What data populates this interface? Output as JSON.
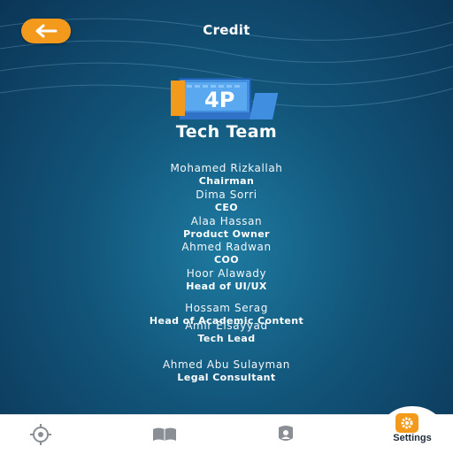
{
  "header": {
    "title": "Credit",
    "back_icon": "arrow-left-icon"
  },
  "team": {
    "title": "Tech Team",
    "logo_text": "4P"
  },
  "members": [
    {
      "name": "Mohamed Rizkallah",
      "role": "Chairman"
    },
    {
      "name": "Dima Sorri",
      "role": "CEO"
    },
    {
      "name": "Alaa Hassan",
      "role": "Product Owner"
    },
    {
      "name": "Ahmed Radwan",
      "role": "COO"
    },
    {
      "name": "Hoor Alawady",
      "role": "Head of UI/UX"
    },
    {
      "name": "Hossam Serag",
      "role": "Head of Academic Content"
    },
    {
      "name": "Amir Elsayyad",
      "role": "Tech Lead"
    },
    {
      "name": "Ahmed Abu Sulayman",
      "role": "Legal Consultant"
    }
  ],
  "nav": {
    "items": [
      {
        "icon": "compass-icon"
      },
      {
        "icon": "book-icon"
      },
      {
        "icon": "profile-icon"
      }
    ],
    "settings": {
      "label": "Settings",
      "icon": "gear-icon"
    }
  },
  "colors": {
    "accent": "#f39a1d",
    "background": "#12557a"
  }
}
